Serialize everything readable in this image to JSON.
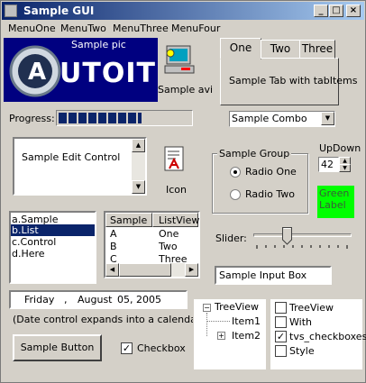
{
  "window": {
    "title": "Sample GUI"
  },
  "titlebar_buttons": {
    "minimize": "_",
    "maximize": "□",
    "close": "×"
  },
  "menu": [
    "MenuOne",
    "MenuTwo",
    "MenuThree",
    "MenuFour"
  ],
  "pic": {
    "caption": "Sample pic",
    "logo_text": "UTOIT",
    "logo_letter": "A"
  },
  "avi": {
    "label": "Sample avi"
  },
  "tabs": {
    "labels": [
      "One",
      "Two",
      "Three"
    ],
    "content": "Sample Tab with tabItems"
  },
  "progress": {
    "label": "Progress:",
    "fraction": 0.63
  },
  "combo": {
    "value": "Sample Combo"
  },
  "edit": {
    "text": "Sample Edit Control"
  },
  "icon": {
    "label": "Icon"
  },
  "group": {
    "title": "Sample Group",
    "radio1": "Radio One",
    "radio2": "Radio Two"
  },
  "updown": {
    "label": "UpDown",
    "value": "42"
  },
  "green_label": {
    "text": "Green\nLabel",
    "color": "#00ff00"
  },
  "list": {
    "items": [
      "a.Sample",
      "b.List",
      "c.Control",
      "d.Here"
    ],
    "selected_index": 1
  },
  "listview": {
    "headers": [
      "Sample",
      "ListView"
    ],
    "rows": [
      [
        "A",
        "One"
      ],
      [
        "B",
        "Two"
      ],
      [
        "C",
        "Three"
      ]
    ]
  },
  "slider": {
    "label": "Slider:",
    "value_fraction": 0.3
  },
  "input": {
    "value": "Sample Input Box"
  },
  "date": {
    "day": "Friday",
    "sep": ",",
    "month": "August",
    "date": "05, 2005",
    "note": "(Date control expands into a calendar)"
  },
  "sample_button": {
    "label": "Sample Button"
  },
  "checkbox": {
    "label": "Checkbox",
    "checked": true,
    "mark": "✓"
  },
  "treeview": {
    "root": "TreeView",
    "items": [
      "Item1",
      "Item2"
    ],
    "expand": "−",
    "collapsed": "+"
  },
  "checktree": {
    "items": [
      {
        "label": "TreeView",
        "checked": false
      },
      {
        "label": "With",
        "checked": false
      },
      {
        "label": "tvs_checkboxes",
        "checked": true
      },
      {
        "label": "Style",
        "checked": false
      }
    ],
    "mark": "✓"
  }
}
